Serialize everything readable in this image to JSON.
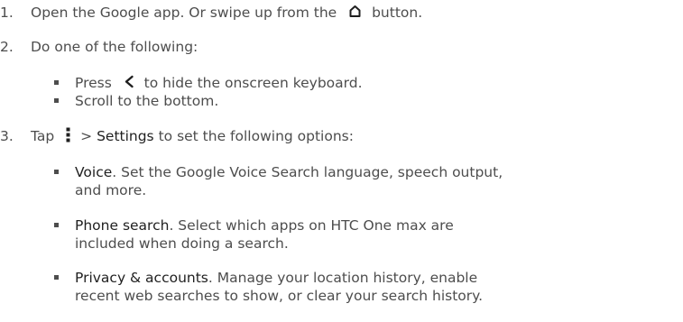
{
  "steps": [
    {
      "number": "1.",
      "text_before_icon": "Open the Google app. Or swipe up from the",
      "icon": "home-icon",
      "text_after_icon": "button."
    },
    {
      "number": "2.",
      "text": "Do one of the following:",
      "bullets": [
        {
          "text_before_icon": "Press",
          "icon": "back-icon",
          "text_after_icon": "to hide the onscreen keyboard."
        },
        {
          "text": "Scroll to the bottom."
        }
      ]
    },
    {
      "number": "3.",
      "text_before_icon": "Tap",
      "icon": "menu-icon",
      "text_mid": ">",
      "text_bold": "Settings",
      "text_after": "to set the following options:",
      "bullets": [
        {
          "title": "Voice",
          "line1": ". Set the Google Voice Search language, speech output,",
          "line2": "and more."
        },
        {
          "title": "Phone search",
          "line1": ". Select which apps on HTC One max are",
          "line2": "included when doing a search."
        },
        {
          "title": "Privacy & accounts",
          "line1": ". Manage your location history, enable",
          "line2": "recent web searches to show, or clear your search history."
        }
      ]
    }
  ]
}
